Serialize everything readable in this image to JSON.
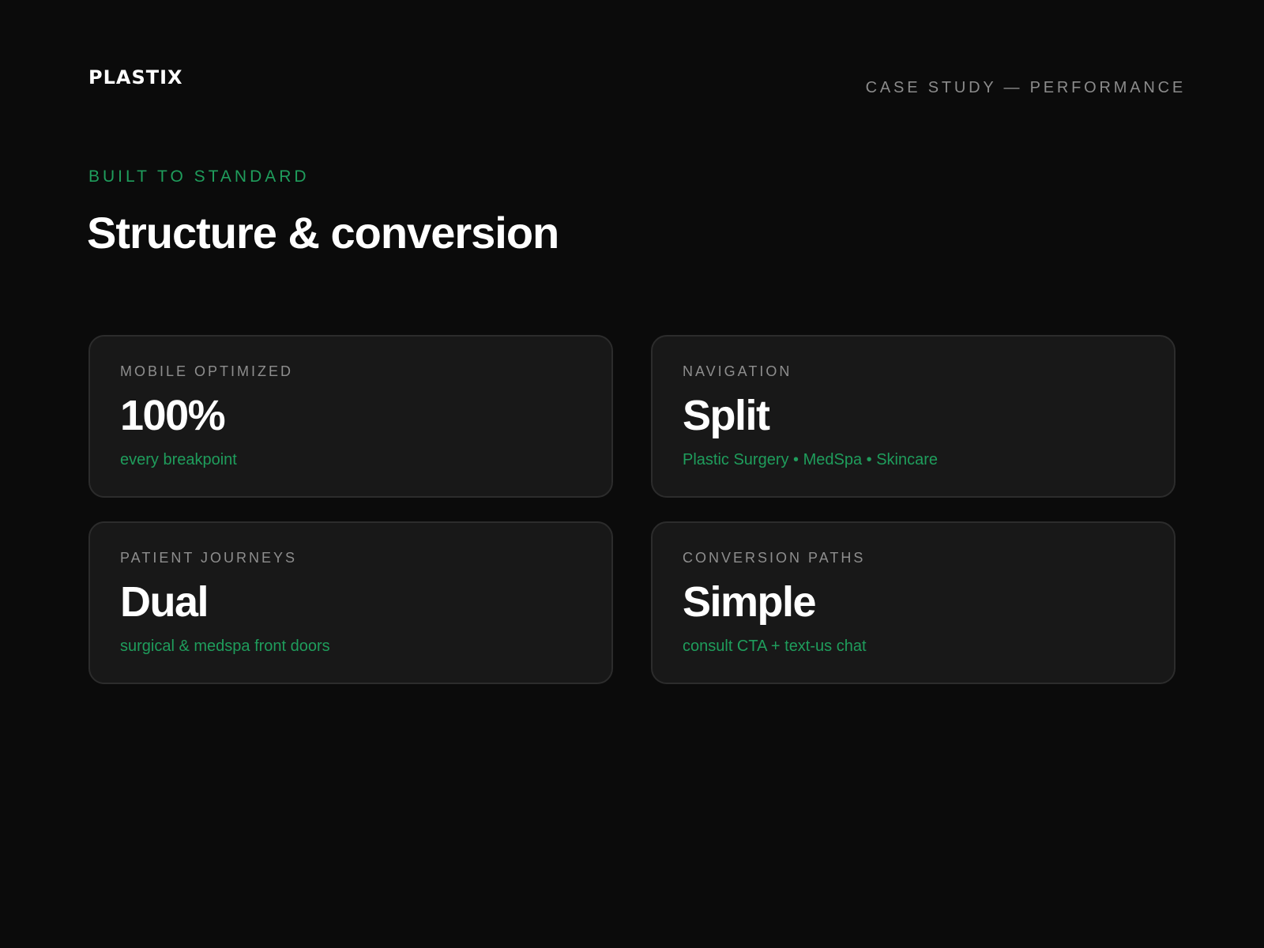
{
  "header": {
    "logo_text": "PLASTIX",
    "case_label": "CASE STUDY — PERFORMANCE"
  },
  "hero": {
    "eyebrow": "BUILT TO STANDARD",
    "title": "Structure & conversion"
  },
  "cards": [
    {
      "label": "MOBILE OPTIMIZED",
      "value": "100%",
      "sub": "every breakpoint"
    },
    {
      "label": "NAVIGATION",
      "value": "Split",
      "sub": "Plastic Surgery • MedSpa • Skincare"
    },
    {
      "label": "PATIENT JOURNEYS",
      "value": "Dual",
      "sub": "surgical & medspa front doors"
    },
    {
      "label": "CONVERSION PATHS",
      "value": "Simple",
      "sub": "consult CTA + text-us chat"
    }
  ],
  "colors": {
    "background": "#0b0b0b",
    "card_background": "#181818",
    "card_border": "#2c2c2c",
    "accent": "#1f9d5c",
    "muted_text": "#8b8b8b",
    "primary_text": "#ffffff"
  }
}
